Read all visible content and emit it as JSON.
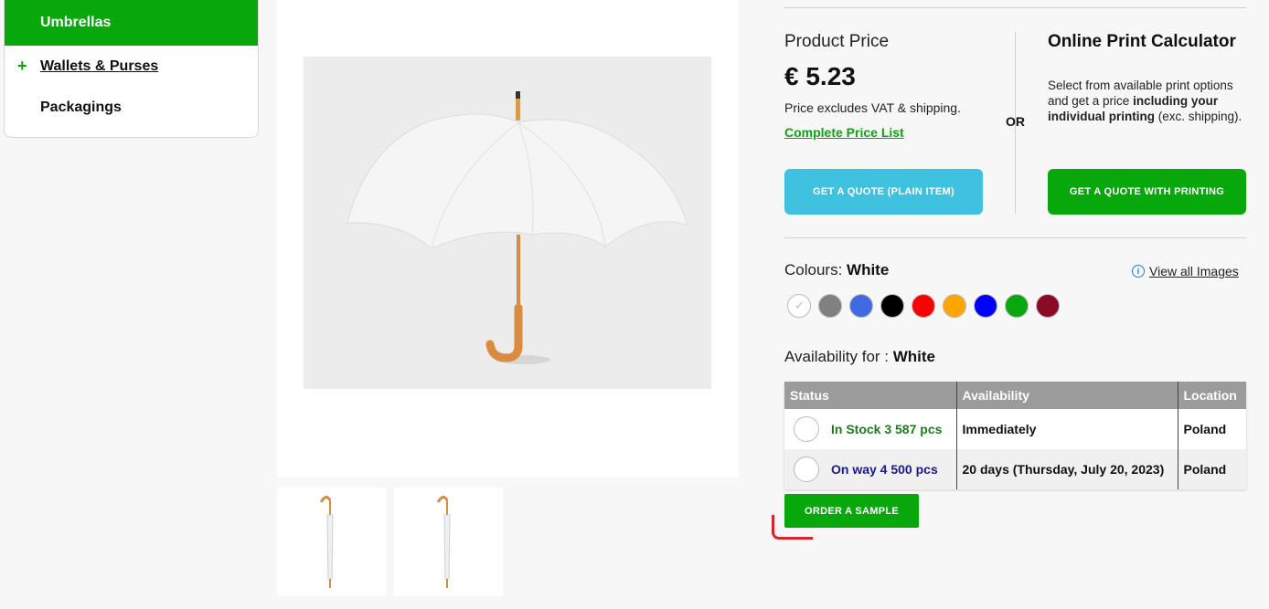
{
  "sidebar": {
    "items": [
      {
        "label": "Umbrellas"
      },
      {
        "label": "Wallets & Purses"
      },
      {
        "label": "Packagings"
      }
    ]
  },
  "pricing": {
    "label": "Product Price",
    "value": "€ 5.23",
    "note": "Price excludes VAT & shipping.",
    "price_list_link": "Complete Price List",
    "or": "OR",
    "calc_title": "Online Print Calculator",
    "calc_text_1": "Select from available print options and get a price ",
    "calc_text_bold": "including your individual printing",
    "calc_text_2": " (exc. shipping).",
    "quote_plain_button": "GET A QUOTE (PLAIN ITEM)",
    "quote_print_button": "GET A QUOTE WITH PRINTING"
  },
  "colours": {
    "label": "Colours: ",
    "selected": "White",
    "view_all": "View all Images",
    "swatches": [
      "#ffffff",
      "#808080",
      "#4169e1",
      "#000000",
      "#ff0000",
      "#ffa500",
      "#0000ff",
      "#08a80c",
      "#8b0a26"
    ]
  },
  "availability": {
    "label": "Availability for : ",
    "selected": "White",
    "headers": [
      "Status",
      "Availability",
      "Location"
    ],
    "rows": [
      {
        "status": "In Stock 3 587 pcs",
        "availability": "Immediately",
        "location": "Poland"
      },
      {
        "status": "On way 4 500 pcs",
        "availability": "20 days (Thursday, July 20, 2023)",
        "location": "Poland"
      }
    ]
  },
  "sample_button": "ORDER A SAMPLE"
}
